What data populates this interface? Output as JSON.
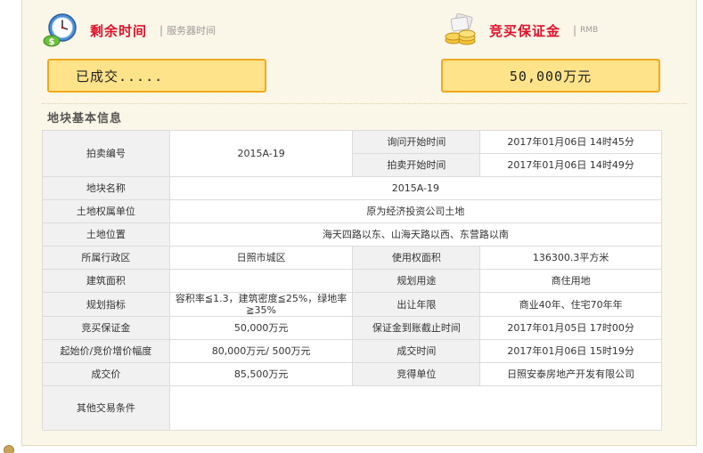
{
  "header": {
    "left": {
      "title": "剩余时间",
      "separator": "|",
      "subtitle": "服务器时间"
    },
    "right": {
      "title": "竞买保证金",
      "separator": "|",
      "subtitle": "RMB"
    }
  },
  "status_box": {
    "value": "已成交....."
  },
  "deposit_box": {
    "value": "50,000万元"
  },
  "section": {
    "title": "地块基本信息"
  },
  "table": {
    "auction_no_label": "拍卖编号",
    "auction_no": "2015A-19",
    "inquiry_start_label": "询问开始时间",
    "inquiry_start": "2017年01月06日 14时45分",
    "auction_start_label": "拍卖开始时间",
    "auction_start": "2017年01月06日 14时49分",
    "parcel_name_label": "地块名称",
    "parcel_name": "2015A-19",
    "owner_label": "土地权属单位",
    "owner": "原为经济投资公司土地",
    "location_label": "土地位置",
    "location": "海天四路以东、山海天路以西、东营路以南",
    "district_label": "所属行政区",
    "district": "日照市城区",
    "use_area_label": "使用权面积",
    "use_area": "136300.3平方米",
    "build_area_label": "建筑面积",
    "build_area": "",
    "planned_use_label": "规划用途",
    "planned_use": "商住用地",
    "planning_label": "规划指标",
    "planning": "容积率≦1.3，建筑密度≦25%，绿地率≧35%",
    "term_label": "出让年限",
    "term": "商业40年、住宅70年年",
    "deposit_label": "竞买保证金",
    "deposit": "50,000万元",
    "deposit_deadline_label": "保证金到账截止时间",
    "deposit_deadline": "2017年01月05日 17时00分",
    "start_price_label": "起始价/竞价增价幅度",
    "start_price": "80,000万元/ 500万元",
    "deal_time_label": "成交时间",
    "deal_time": "2017年01月06日 15时19分",
    "deal_price_label": "成交价",
    "deal_price": "85,500万元",
    "winner_label": "竞得单位",
    "winner": "日照安泰房地产开发有限公司",
    "other_label": "其他交易条件",
    "other": ""
  }
}
